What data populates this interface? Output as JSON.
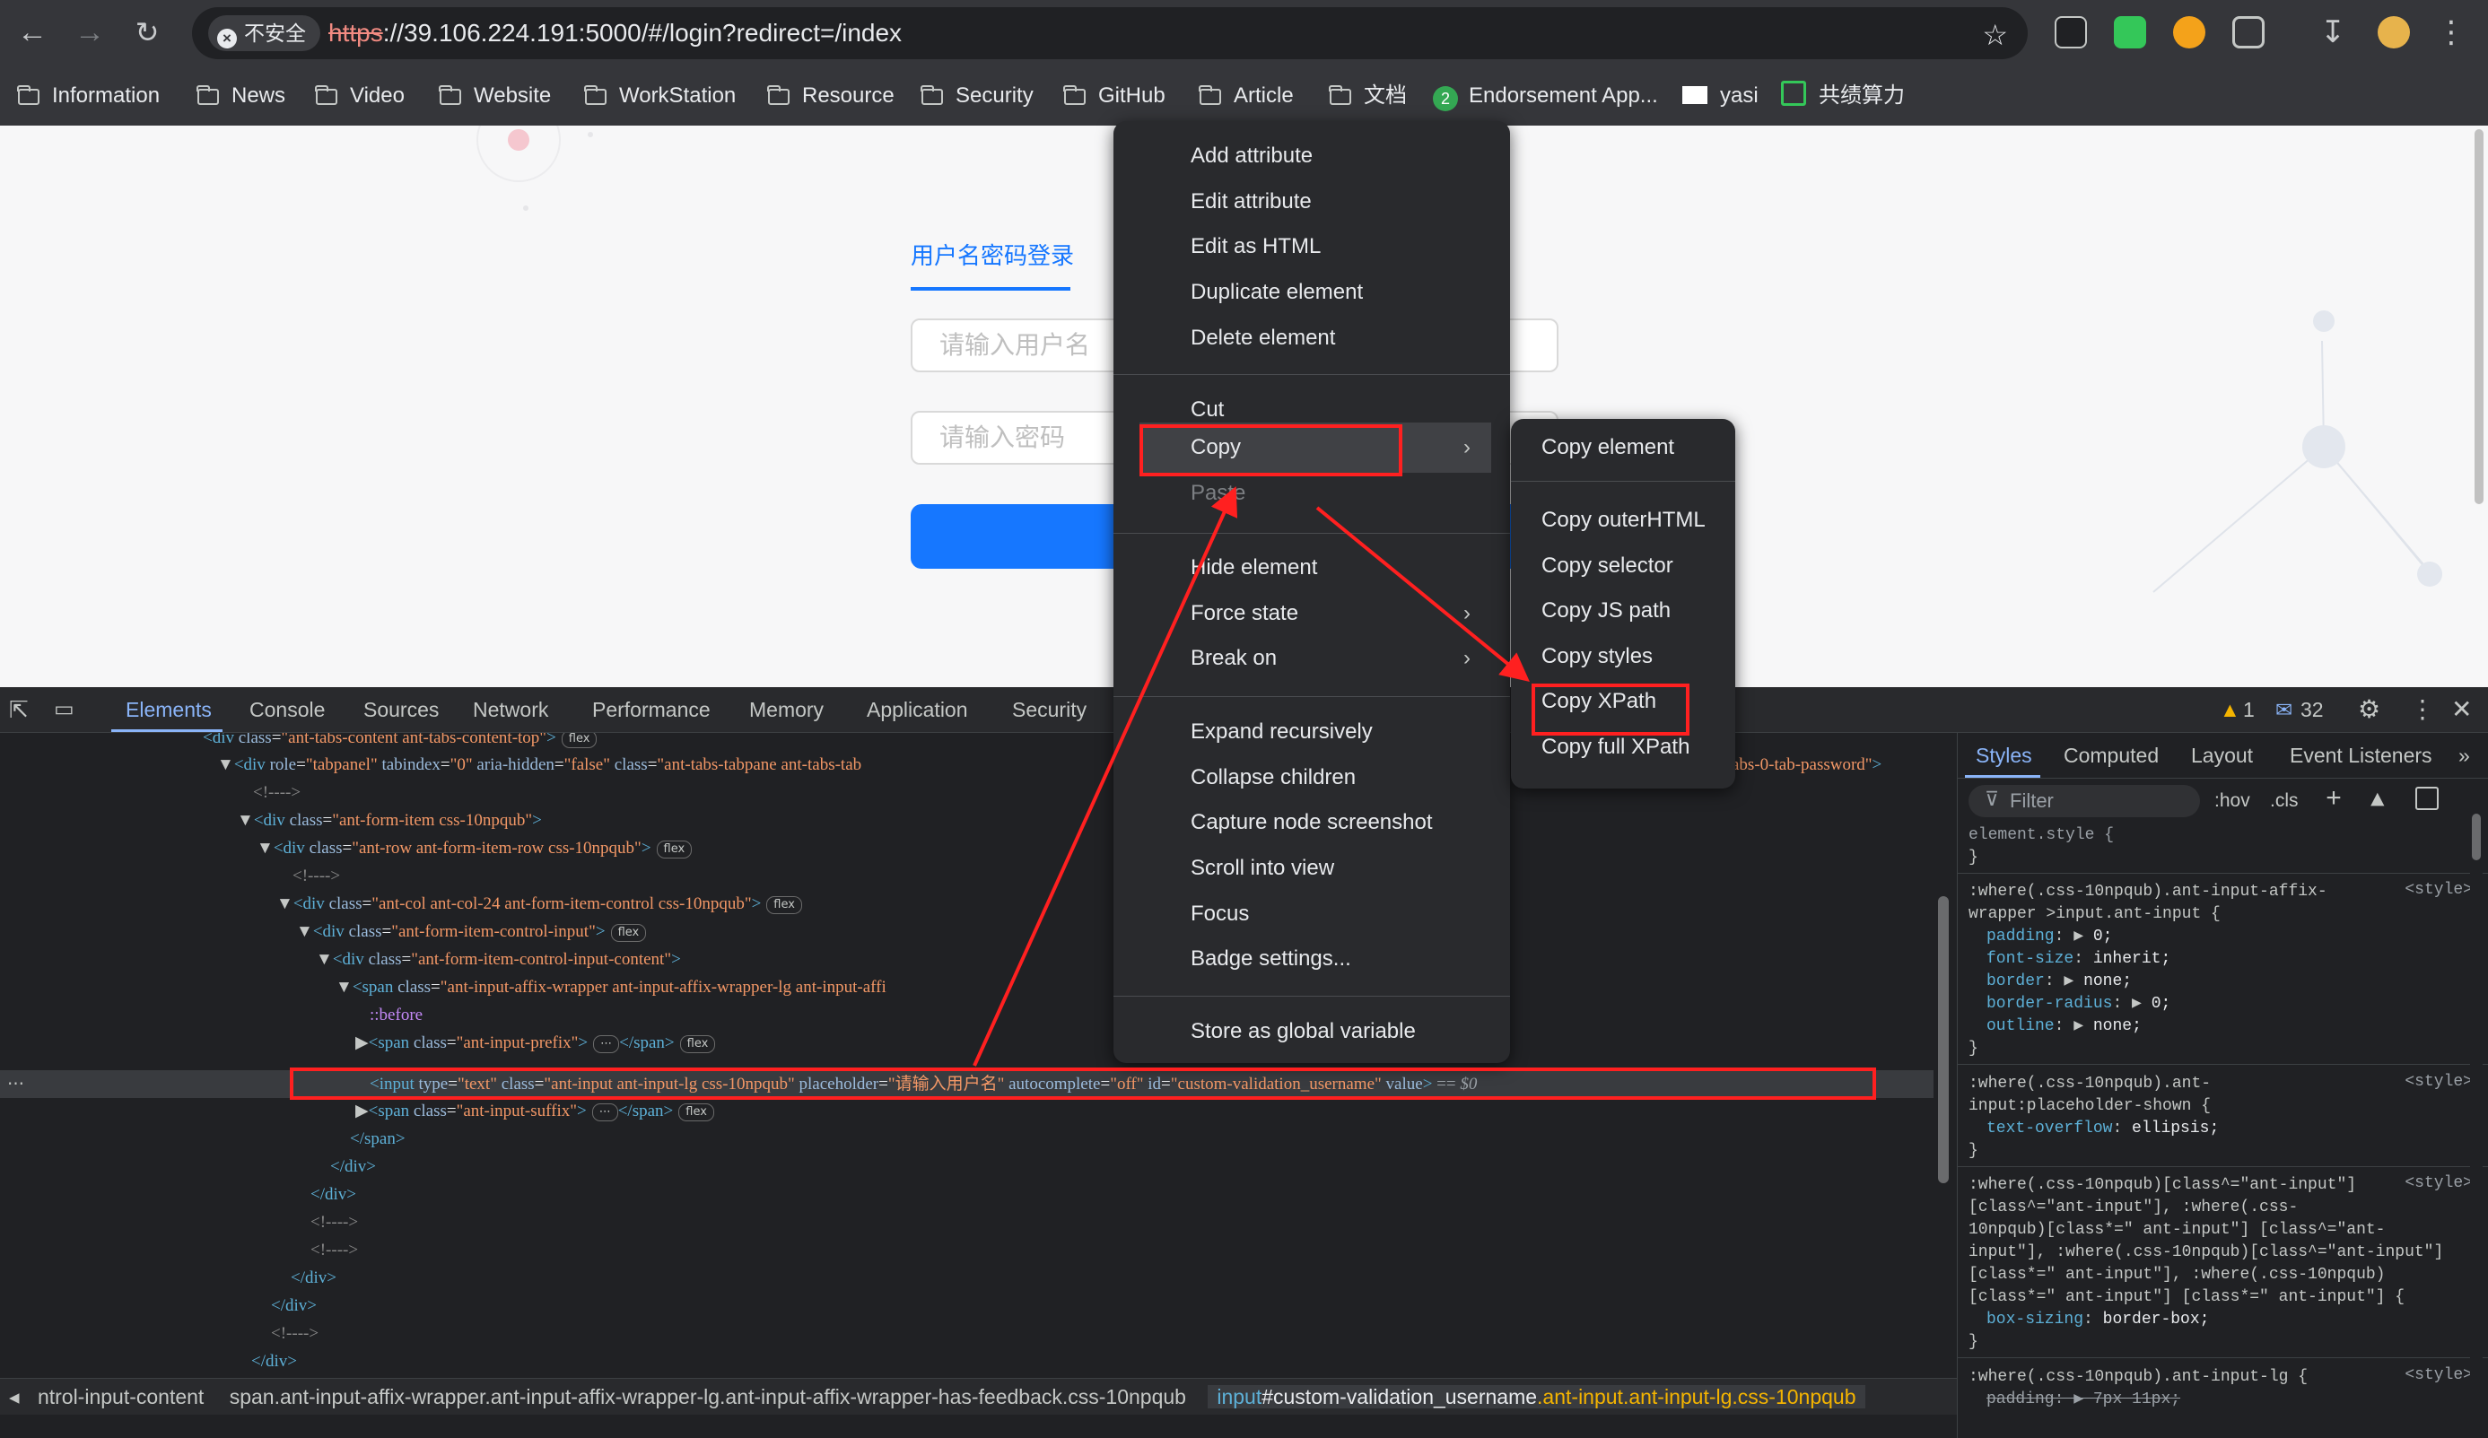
{
  "browser": {
    "security_label": "不安全",
    "url_scheme": "https",
    "url_rest": "://39.106.224.191:5000/#/login?redirect=/index"
  },
  "bookmarks": [
    "Information",
    "News",
    "Video",
    "Website",
    "WorkStation",
    "Resource",
    "Security",
    "GitHub",
    "Article",
    "文档",
    "Endorsement App...",
    "yasi",
    "共绩算力"
  ],
  "page": {
    "login_tab": "用户名密码登录",
    "username_placeholder": "请输入用户名",
    "password_placeholder": "请输入密码"
  },
  "devtools": {
    "tabs": [
      "Elements",
      "Console",
      "Sources",
      "Network",
      "Performance",
      "Memory",
      "Application",
      "Security"
    ],
    "warnings": "1",
    "messages": "32",
    "styles_tabs": [
      "Styles",
      "Computed",
      "Layout",
      "Event Listeners"
    ],
    "filter_placeholder": "Filter",
    "hov": ":hov",
    "cls": ".cls",
    "breadcrumbs": {
      "c1": "ntrol-input-content",
      "c2": "span.ant-input-affix-wrapper.ant-input-affix-wrapper-lg.ant-input-affix-wrapper-has-feedback.css-10npqub",
      "c3_tag": "input",
      "c3_id": "#custom-validation_username",
      "c3_cls": ".ant-input.ant-input-lg.css-10npqub"
    }
  },
  "context_menu": {
    "items": [
      "Add attribute",
      "Edit attribute",
      "Edit as HTML",
      "Duplicate element",
      "Delete element",
      "Cut",
      "Copy",
      "Paste",
      "Hide element",
      "Force state",
      "Break on",
      "Expand recursively",
      "Collapse children",
      "Capture node screenshot",
      "Scroll into view",
      "Focus",
      "Badge settings...",
      "Store as global variable"
    ]
  },
  "copy_submenu": {
    "items": [
      "Copy element",
      "Copy outerHTML",
      "Copy selector",
      "Copy JS path",
      "Copy styles",
      "Copy XPath",
      "Copy full XPath"
    ]
  },
  "colors": {
    "highlight": "#ff2020",
    "accent": "#1677ff",
    "devtools_bg": "#202124"
  }
}
